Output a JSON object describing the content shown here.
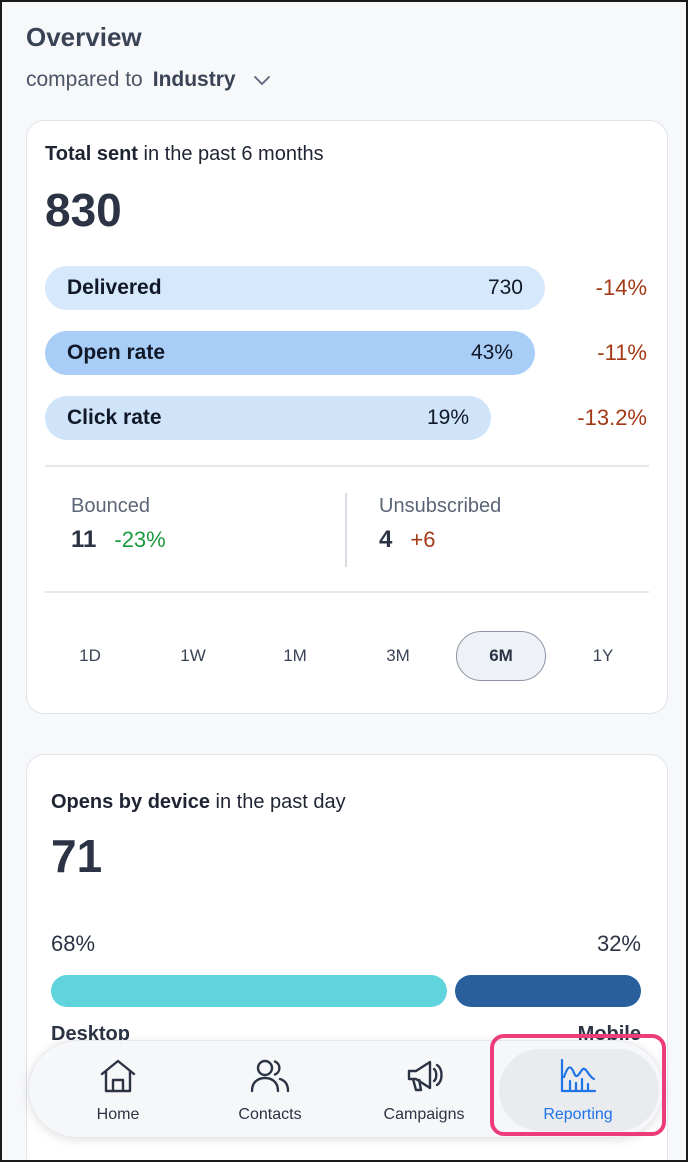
{
  "header": {
    "title": "Overview",
    "compared_prefix": "compared to",
    "compared_value": "Industry"
  },
  "total_sent": {
    "heading_bold": "Total sent",
    "heading_rest": " in the past 6 months",
    "total": "830",
    "metrics": [
      {
        "label": "Delivered",
        "value": "730",
        "change": "-14%",
        "fill": 0.88,
        "color": "#d6e8fc"
      },
      {
        "label": "Open rate",
        "value": "43%",
        "change": "-11%",
        "fill": 0.43,
        "color": "#a8cdf7"
      },
      {
        "label": "Click rate",
        "value": "19%",
        "change": "-13.2%",
        "fill": 0.19,
        "color": "#cfe3f9"
      }
    ],
    "bounced": {
      "label": "Bounced",
      "value": "11",
      "change": "-23%"
    },
    "unsubscribed": {
      "label": "Unsubscribed",
      "value": "4",
      "change": "+6"
    },
    "ranges": [
      "1D",
      "1W",
      "1M",
      "3M",
      "6M",
      "1Y"
    ],
    "active_range": "6M"
  },
  "opens_by_device": {
    "heading_bold": "Opens by device",
    "heading_rest": " in the past day",
    "total": "71",
    "desktop_pct": "68%",
    "mobile_pct": "32%",
    "desktop_fraction": 0.68,
    "mobile_fraction": 0.32,
    "desktop_label": "Desktop",
    "mobile_label": "Mobile",
    "desktop_color": "#5fd4dd",
    "mobile_color": "#2a5f9e"
  },
  "nav": {
    "items": [
      {
        "label": "Home",
        "icon": "home-icon"
      },
      {
        "label": "Contacts",
        "icon": "contacts-icon"
      },
      {
        "label": "Campaigns",
        "icon": "megaphone-icon"
      },
      {
        "label": "Reporting",
        "icon": "chart-icon"
      }
    ],
    "active": "Reporting"
  }
}
